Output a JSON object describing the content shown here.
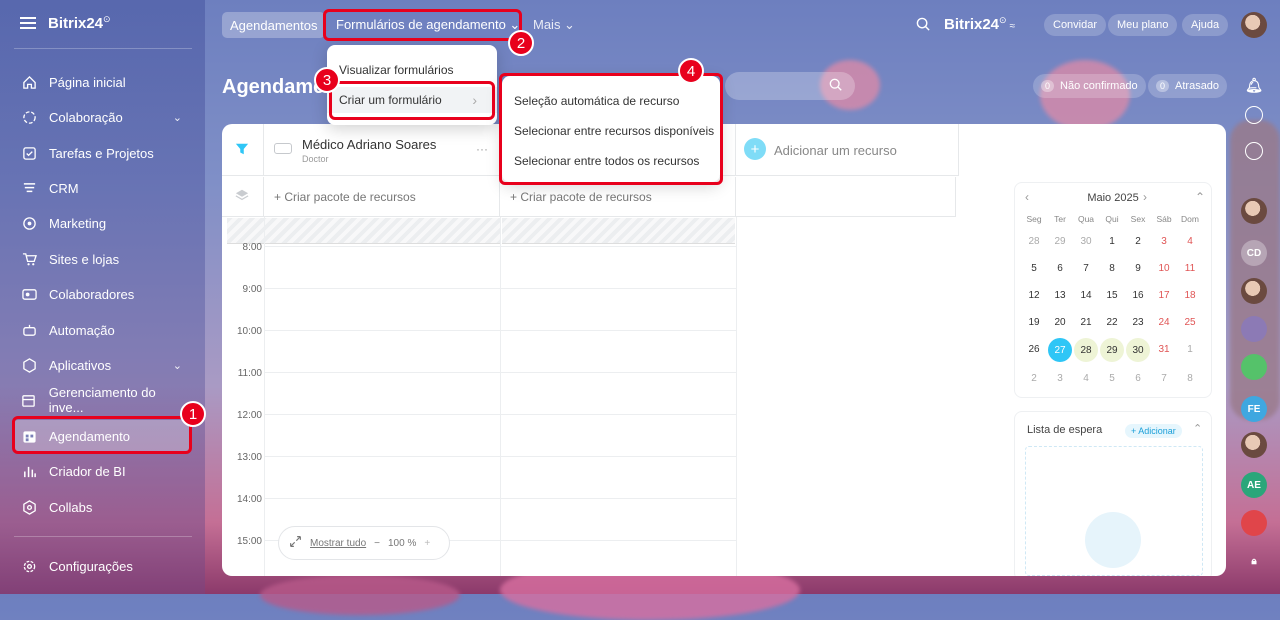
{
  "sidebar": {
    "brand": "Bitrix24",
    "brand_mark": "⊙",
    "items": [
      {
        "label": "Página inicial",
        "icon": "home-icon"
      },
      {
        "label": "Colaboração",
        "icon": "chat-icon"
      },
      {
        "label": "Tarefas e Projetos",
        "icon": "check-icon"
      },
      {
        "label": "CRM",
        "icon": "crm-icon"
      },
      {
        "label": "Marketing",
        "icon": "marketing-icon"
      },
      {
        "label": "Sites e lojas",
        "icon": "cart-icon"
      },
      {
        "label": "Colaboradores",
        "icon": "people-icon"
      },
      {
        "label": "Automação",
        "icon": "robot-icon"
      },
      {
        "label": "Aplicativos",
        "icon": "apps-icon"
      },
      {
        "label": "Gerenciamento do inve...",
        "icon": "inventory-icon"
      },
      {
        "label": "Agendamento",
        "icon": "calendar-icon"
      },
      {
        "label": "Criador de BI",
        "icon": "bi-icon"
      },
      {
        "label": "Collabs",
        "icon": "collabs-icon"
      }
    ],
    "settings_label": "Configurações"
  },
  "topbar": {
    "tab_bookings": "Agendamentos",
    "tab_forms": "Formulários de agendamento ⌄",
    "tab_more": "Mais ⌄",
    "brand": "Bitrix24",
    "invite": "Convidar",
    "plan": "Meu plano",
    "help": "Ajuda"
  },
  "header": {
    "title": "Agendamentos",
    "unconfirmed_count": "0",
    "unconfirmed_label": "Não confirmado",
    "late_count": "0",
    "late_label": "Atrasado"
  },
  "forms_menu": {
    "view": "Visualizar formulários",
    "create": "Criar um formulário",
    "create_arrow": "›"
  },
  "create_submenu": {
    "auto": "Seleção automática de recurso",
    "available": "Selecionar entre recursos disponíveis",
    "all": "Selecionar entre todos os recursos"
  },
  "resource": {
    "name": "Médico Adriano Soares",
    "type": "Doctor",
    "more": "···",
    "add_label": "Adicionar um recurso",
    "create_package": "+ Criar pacote de recursos"
  },
  "times": [
    "8:00",
    "9:00",
    "10:00",
    "11:00",
    "12:00",
    "13:00",
    "14:00",
    "15:00"
  ],
  "zoom": {
    "show_all": "Mostrar tudo",
    "minus": "−",
    "value": "100 %",
    "plus": "+"
  },
  "calendar": {
    "month": "Maio 2025",
    "weekdays": [
      "Seg",
      "Ter",
      "Qua",
      "Qui",
      "Sex",
      "Sáb",
      "Dom"
    ],
    "days": [
      "28",
      "29",
      "30",
      "1",
      "2",
      "3",
      "4",
      "5",
      "6",
      "7",
      "8",
      "9",
      "10",
      "11",
      "12",
      "13",
      "14",
      "15",
      "16",
      "17",
      "18",
      "19",
      "20",
      "21",
      "22",
      "23",
      "24",
      "25",
      "26",
      "27",
      "28",
      "29",
      "30",
      "31",
      "1",
      "2",
      "3",
      "4",
      "5",
      "6",
      "7",
      "8"
    ]
  },
  "waitlist": {
    "title": "Lista de espera",
    "add": "+ Adicionar"
  },
  "rail": {
    "cd": "CD",
    "fe": "FE",
    "ae": "AE"
  },
  "annotations": [
    "1",
    "2",
    "3",
    "4"
  ],
  "colors": {
    "accent": "#2fc6f6",
    "callout": "#e8001c"
  }
}
